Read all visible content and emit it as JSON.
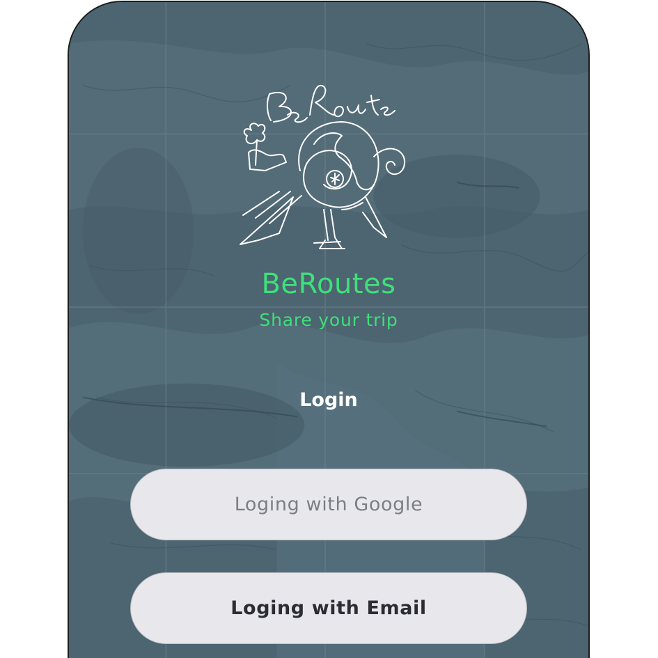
{
  "app": {
    "name": "BeRoutes",
    "tagline": "Share your trip",
    "logo_icon": "beroute-globe-logo-icon",
    "logo_text": "BeRoute"
  },
  "login": {
    "heading": "Login",
    "google_button": "Loging with Google",
    "email_button": "Loging with Email"
  },
  "colors": {
    "accent": "#3ee07a",
    "background": "#4e6572",
    "button_bg": "#e8e8ec",
    "google_text": "#7b7e85",
    "email_text": "#2b2d33"
  }
}
